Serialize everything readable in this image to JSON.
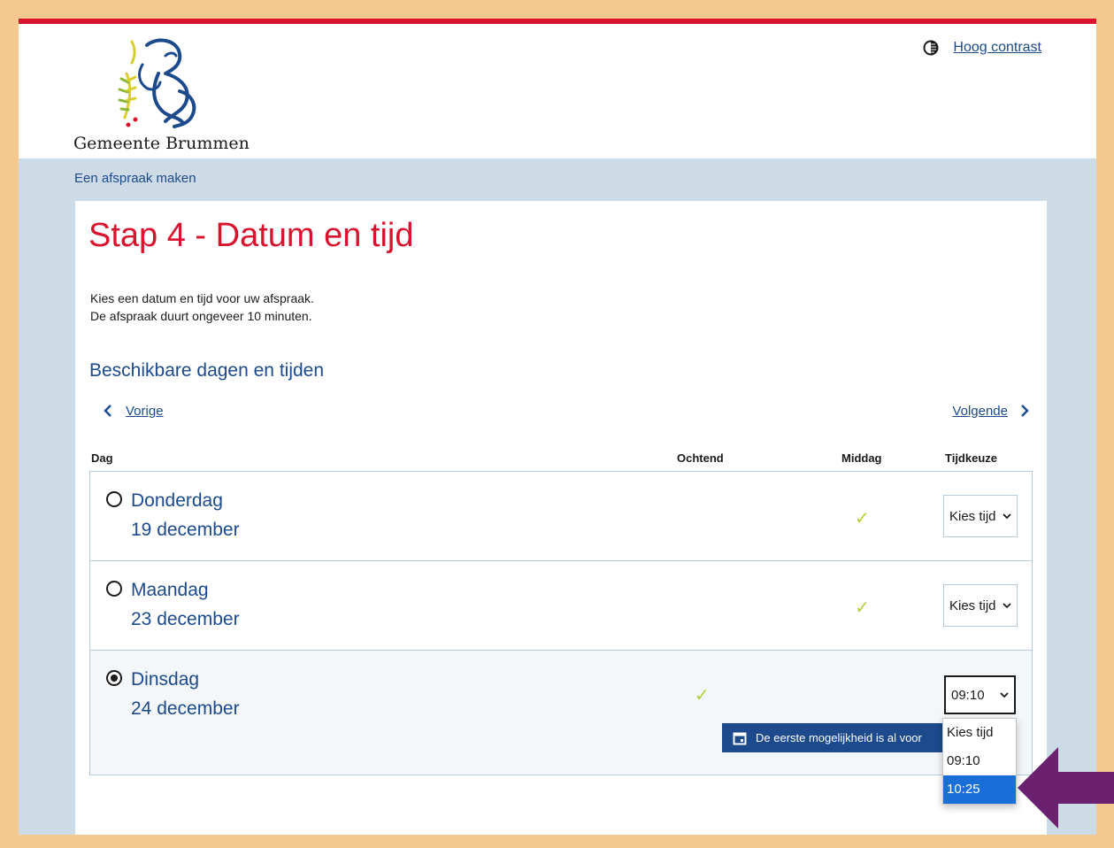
{
  "header": {
    "logo_text": "Gemeente Brummen",
    "contrast_link": "Hoog contrast"
  },
  "breadcrumb": "Een afspraak maken",
  "page": {
    "title": "Stap 4 - Datum en tijd",
    "intro_line1": "Kies een datum en tijd voor uw afspraak.",
    "intro_line2": "De afspraak duurt ongeveer 10 minuten.",
    "section_title": "Beschikbare dagen en tijden",
    "prev_label": "Vorige",
    "next_label": "Volgende"
  },
  "table": {
    "columns": [
      "Dag",
      "Ochtend",
      "Middag",
      "Tijdkeuze"
    ],
    "rows": [
      {
        "day": "Donderdag",
        "date": "19 december",
        "ochtend": "",
        "middag": "✓",
        "selected_time": "Kies tijd",
        "checked": false
      },
      {
        "day": "Maandag",
        "date": "23 december",
        "ochtend": "",
        "middag": "✓",
        "selected_time": "Kies tijd",
        "checked": false
      },
      {
        "day": "Dinsdag",
        "date": "24 december",
        "ochtend": "✓",
        "middag": "",
        "selected_time": "09:10",
        "checked": true
      }
    ]
  },
  "notice": "De eerste mogelijkheid is al voor",
  "dropdown": {
    "options": [
      "Kies tijd",
      "09:10",
      "10:25"
    ],
    "highlighted": "10:25"
  },
  "colors": {
    "accent_red": "#d9132e",
    "link_blue": "#1c4a8c",
    "check_green": "#b9cf3a",
    "highlight": "#1a6ed8",
    "arrow_purple": "#6b2070",
    "frame_orange": "#f5c88f"
  }
}
